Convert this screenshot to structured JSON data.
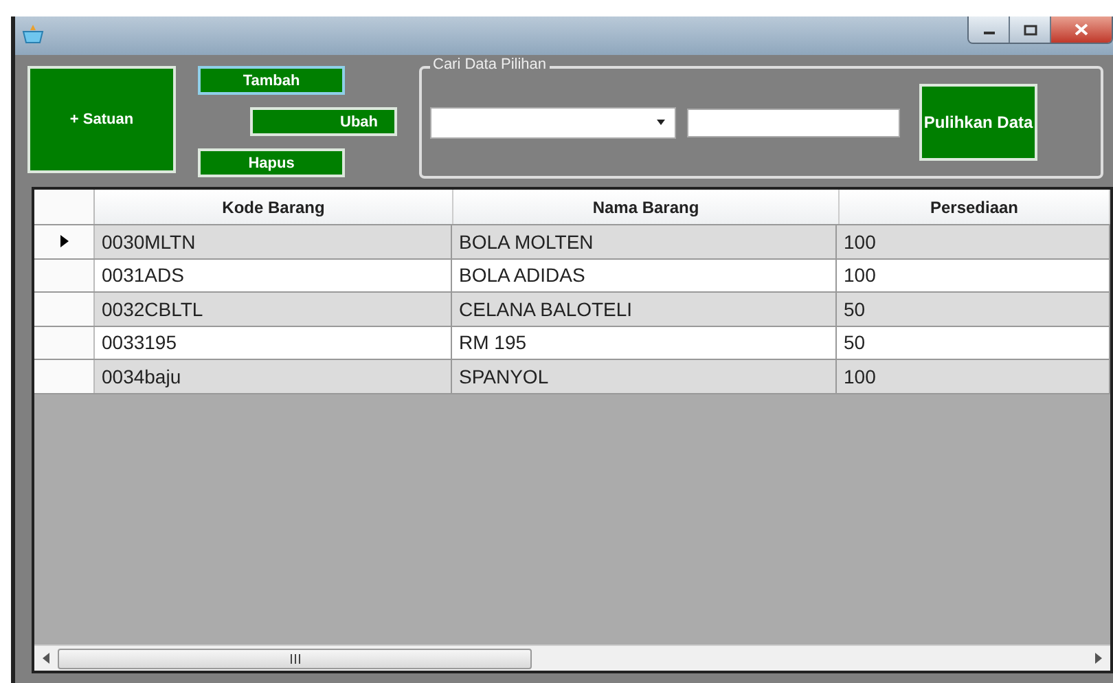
{
  "buttons": {
    "satuan": "+ Satuan",
    "tambah": "Tambah",
    "ubah": "Ubah",
    "hapus": "Hapus",
    "pulihkan": "Pulihkan Data"
  },
  "search_group": {
    "title": "Cari Data Pilihan"
  },
  "table": {
    "columns": [
      "Kode Barang",
      "Nama Barang",
      "Persediaan"
    ],
    "rows": [
      {
        "cells": [
          "0030MLTN",
          "BOLA MOLTEN",
          "100"
        ],
        "selected": true
      },
      {
        "cells": [
          "0031ADS",
          "BOLA ADIDAS",
          "100"
        ],
        "selected": false
      },
      {
        "cells": [
          "0032CBLTL",
          "CELANA BALOTELI",
          "50"
        ],
        "selected": false
      },
      {
        "cells": [
          "0033195",
          "RM 195",
          "50"
        ],
        "selected": false
      },
      {
        "cells": [
          "0034baju",
          "SPANYOL",
          "100"
        ],
        "selected": false
      }
    ]
  }
}
